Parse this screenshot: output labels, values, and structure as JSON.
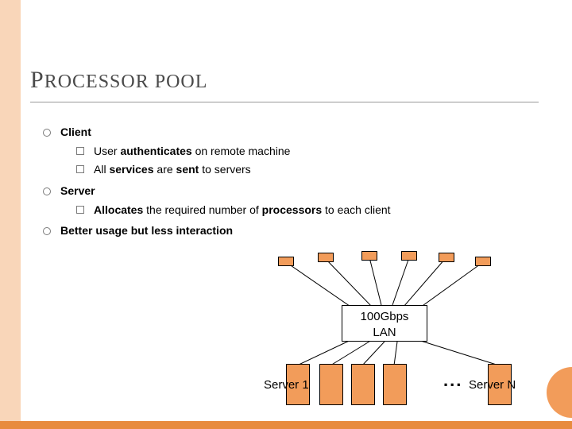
{
  "title_first": "P",
  "title_word1_rest": "ROCESSOR",
  "title_word2": " POOL",
  "bullets": {
    "client_label": "Client",
    "client_sub1_pre": "User ",
    "client_sub1_b1": "authenticates",
    "client_sub1_post": " on remote machine",
    "client_sub2_pre": "All ",
    "client_sub2_b1": "services",
    "client_sub2_mid": " are ",
    "client_sub2_b2": "sent",
    "client_sub2_post": " to servers",
    "server_label": "Server",
    "server_sub1_b1": "Allocates",
    "server_sub1_mid": " the required number of ",
    "server_sub1_b2": "processors",
    "server_sub1_post": " to each client",
    "better": "Better usage but less interaction"
  },
  "diagram": {
    "lan_line1": "100Gbps",
    "lan_line2": "LAN",
    "server1_label": "Server 1",
    "serverN_label": "Server N",
    "dots": "..."
  }
}
